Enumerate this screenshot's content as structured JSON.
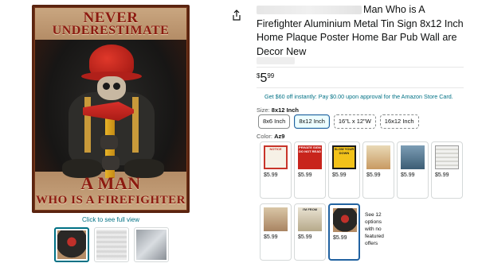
{
  "image": {
    "sign_line1": "NEVER",
    "sign_line2": "UNDERESTIMATE",
    "sign_line3": "A MAN",
    "sign_line4": "WHO IS A FIREFIGHTER",
    "see_full_view": "Click to see full view"
  },
  "product": {
    "title": "Man Who is A Firefighter Aluminium Metal Tin Sign 8x12 Inch Home Plaque Poster Home Bar Pub Wall are Decor New",
    "price_symbol": "$",
    "price_whole": "5",
    "price_fraction": "99",
    "promo": "Get $60 off instantly: Pay $0.00 upon approval for the Amazon Store Card."
  },
  "size": {
    "label": "Size:",
    "selected": "8x12 Inch",
    "options": [
      "8x6 Inch",
      "8x12 Inch",
      "16\"L x 12\"W",
      "16x12 Inch"
    ]
  },
  "color": {
    "label": "Color:",
    "selected": "Az9",
    "swatches": [
      {
        "price": "$5.99",
        "art": "NOTICE"
      },
      {
        "price": "$5.99",
        "art": "PRIVATE SIGN DO NOT READ"
      },
      {
        "price": "$5.99",
        "art": "SLOW YOUR DOWN"
      },
      {
        "price": "$5.99",
        "art": ""
      },
      {
        "price": "$5.99",
        "art": ""
      },
      {
        "price": "$5.99",
        "art": ""
      },
      {
        "price": "$5.99",
        "art": ""
      },
      {
        "price": "$5.99",
        "art": "I'M FROM"
      },
      {
        "price": "$5.99",
        "art": ""
      }
    ],
    "more_options": "See 12 options with no featured offers"
  },
  "icons": {
    "share": "share-icon"
  }
}
